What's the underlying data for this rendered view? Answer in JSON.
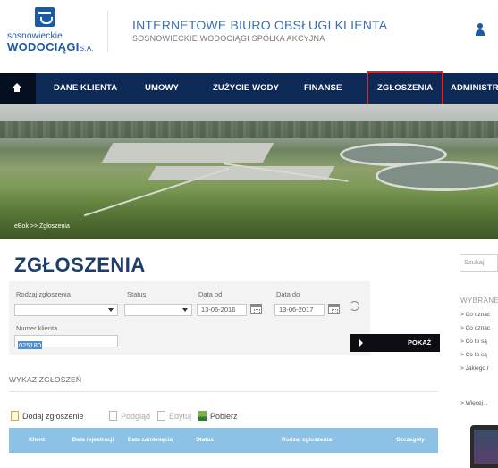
{
  "logo": {
    "line1": "sosnowieckie",
    "line2": "WODOCIĄGI",
    "line2_suffix": "S.A."
  },
  "header": {
    "title": "INTERNETOWE BIURO OBSŁUGI KLIENTA",
    "subtitle": "SOSNOWIECKIE WODOCIĄGI SPÓŁKA AKCYJNA"
  },
  "nav": {
    "items": [
      {
        "label": "DANE KLIENTA"
      },
      {
        "label": "UMOWY"
      },
      {
        "label": "ZUŻYCIE WODY"
      },
      {
        "label": "FINANSE"
      },
      {
        "label": "ZGŁOSZENIA",
        "highlighted": true
      },
      {
        "label": "ADMINISTR"
      }
    ],
    "bg_color": "#0c2a55",
    "highlight_color": "#e0242c"
  },
  "breadcrumb": "eBok  >>  Zgłoszenia",
  "page_title": "ZGŁOSZENIA",
  "form": {
    "rodzaj_label": "Rodzaj zgłoszenia",
    "rodzaj_value": "",
    "status_label": "Status",
    "status_value": "",
    "date_from_label": "Data od",
    "date_from_value": "13-06-2016",
    "date_to_label": "Data do",
    "date_to_value": "13-06-2017",
    "client_label": "Numer klienta",
    "client_value": "025180",
    "show_button": "POKAŻ"
  },
  "list": {
    "title": "WYKAZ ZGŁOSZEŃ",
    "toolbar": {
      "add": "Dodaj zgłoszenie",
      "preview": "Podgląd",
      "edit": "Edytuj",
      "download": "Pobierz"
    },
    "columns": [
      "Klient",
      "Data rejestracji",
      "Data zamknięcia",
      "Status",
      "Rodzaj zgłoszenia",
      "Szczegóły"
    ],
    "header_color": "#8cc2e6"
  },
  "sidebar": {
    "search_placeholder": "Szukaj",
    "heading": "WYBRANE",
    "links": [
      "> Co oznac",
      "> Co oznac",
      "> Co to są",
      "> Co to są",
      "> Jakiego r"
    ],
    "more": "> Więcej..."
  }
}
